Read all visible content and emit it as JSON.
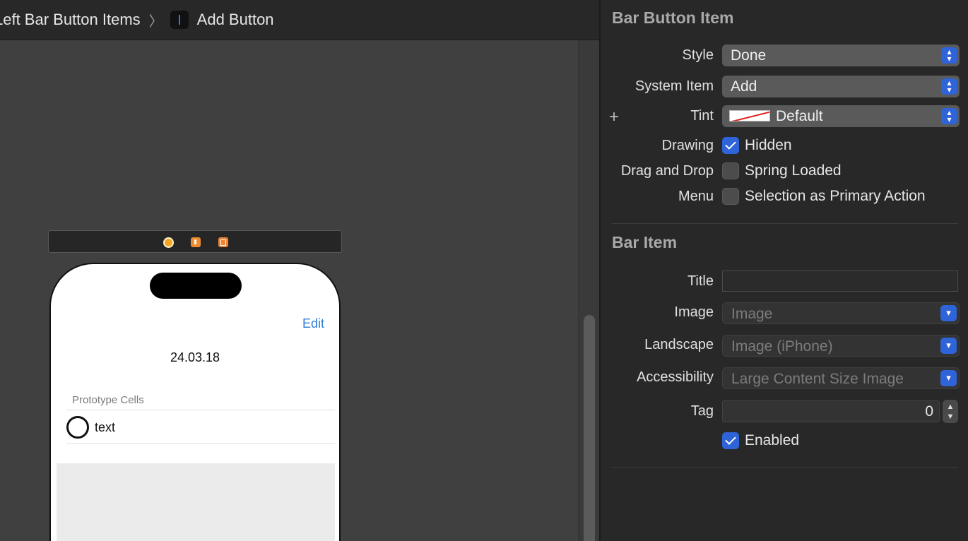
{
  "jumpbar": {
    "prev_crumb": "Left Bar Button Items",
    "separator": "〉",
    "current_crumb": "Add Button"
  },
  "scene": {
    "nav_button": "Edit",
    "date_label": "24.03.18",
    "section_header": "Prototype Cells",
    "cell_text": "text"
  },
  "inspector": {
    "bar_button_item": {
      "title": "Bar Button Item",
      "style_label": "Style",
      "style_value": "Done",
      "system_item_label": "System Item",
      "system_item_value": "Add",
      "tint_label": "Tint",
      "tint_value": "Default",
      "drawing_label": "Drawing",
      "hidden_label": "Hidden",
      "hidden_checked": true,
      "drag_drop_label": "Drag and Drop",
      "spring_loaded_label": "Spring Loaded",
      "spring_loaded_checked": false,
      "menu_label": "Menu",
      "primary_action_label": "Selection as Primary Action",
      "primary_action_checked": false
    },
    "bar_item": {
      "title": "Bar Item",
      "title_label": "Title",
      "title_value": "",
      "image_label": "Image",
      "image_placeholder": "Image",
      "landscape_label": "Landscape",
      "landscape_placeholder": "Image (iPhone)",
      "accessibility_label": "Accessibility",
      "accessibility_placeholder": "Large Content Size Image",
      "tag_label": "Tag",
      "tag_value": "0",
      "enabled_label": "Enabled",
      "enabled_checked": true
    }
  },
  "icons": {
    "popup_stepper": "up-down-chevron-icon",
    "popup_dropdown": "chevron-down-icon",
    "add": "plus-icon"
  },
  "colors": {
    "accent": "#2f63d8",
    "link": "#2f7bd9"
  }
}
